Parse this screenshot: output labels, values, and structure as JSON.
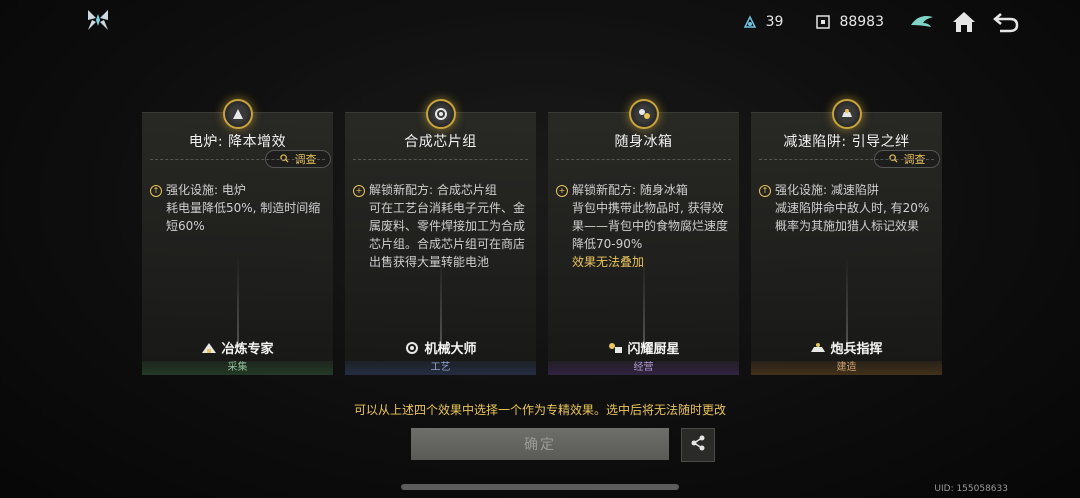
{
  "topbar": {
    "energy_value": "39",
    "currency_value": "88983"
  },
  "cards": [
    {
      "title": "电炉: 降本增效",
      "inspect": "调查",
      "line1": "强化设施: 电炉",
      "body": "耗电量降低50%, 制造时间缩短60%",
      "highlight": "",
      "role": "冶炼专家",
      "category": "采集"
    },
    {
      "title": "合成芯片组",
      "inspect": "",
      "line1": "解锁新配方: 合成芯片组",
      "body": "可在工艺台消耗电子元件、金属废料、零件焊接加工为合成芯片组。合成芯片组可在商店出售获得大量转能电池",
      "highlight": "",
      "role": "机械大师",
      "category": "工艺"
    },
    {
      "title": "随身冰箱",
      "inspect": "",
      "line1": "解锁新配方: 随身冰箱",
      "body": "背包中携带此物品时, 获得效果——背包中的食物腐烂速度降低70-90%",
      "highlight": "效果无法叠加",
      "role": "闪耀厨星",
      "category": "经营"
    },
    {
      "title": "减速陷阱: 引导之绊",
      "inspect": "调查",
      "line1": "强化设施: 减速陷阱",
      "body": "减速陷阱命中敌人时, 有20%概率为其施加猎人标记效果",
      "highlight": "",
      "role": "炮兵指挥",
      "category": "建造"
    }
  ],
  "notice": "可以从上述四个效果中选择一个作为专精效果。选中后将无法随时更改",
  "confirm_label": "确定",
  "uid": "UID: 155058633",
  "colors": {
    "accent": "#e8c45a",
    "badge_border": "#c9a43c"
  },
  "icons": [
    "logo-icon",
    "energy-icon",
    "currency-icon",
    "emblem-icon",
    "home-icon",
    "back-icon",
    "search-icon",
    "share-icon"
  ]
}
